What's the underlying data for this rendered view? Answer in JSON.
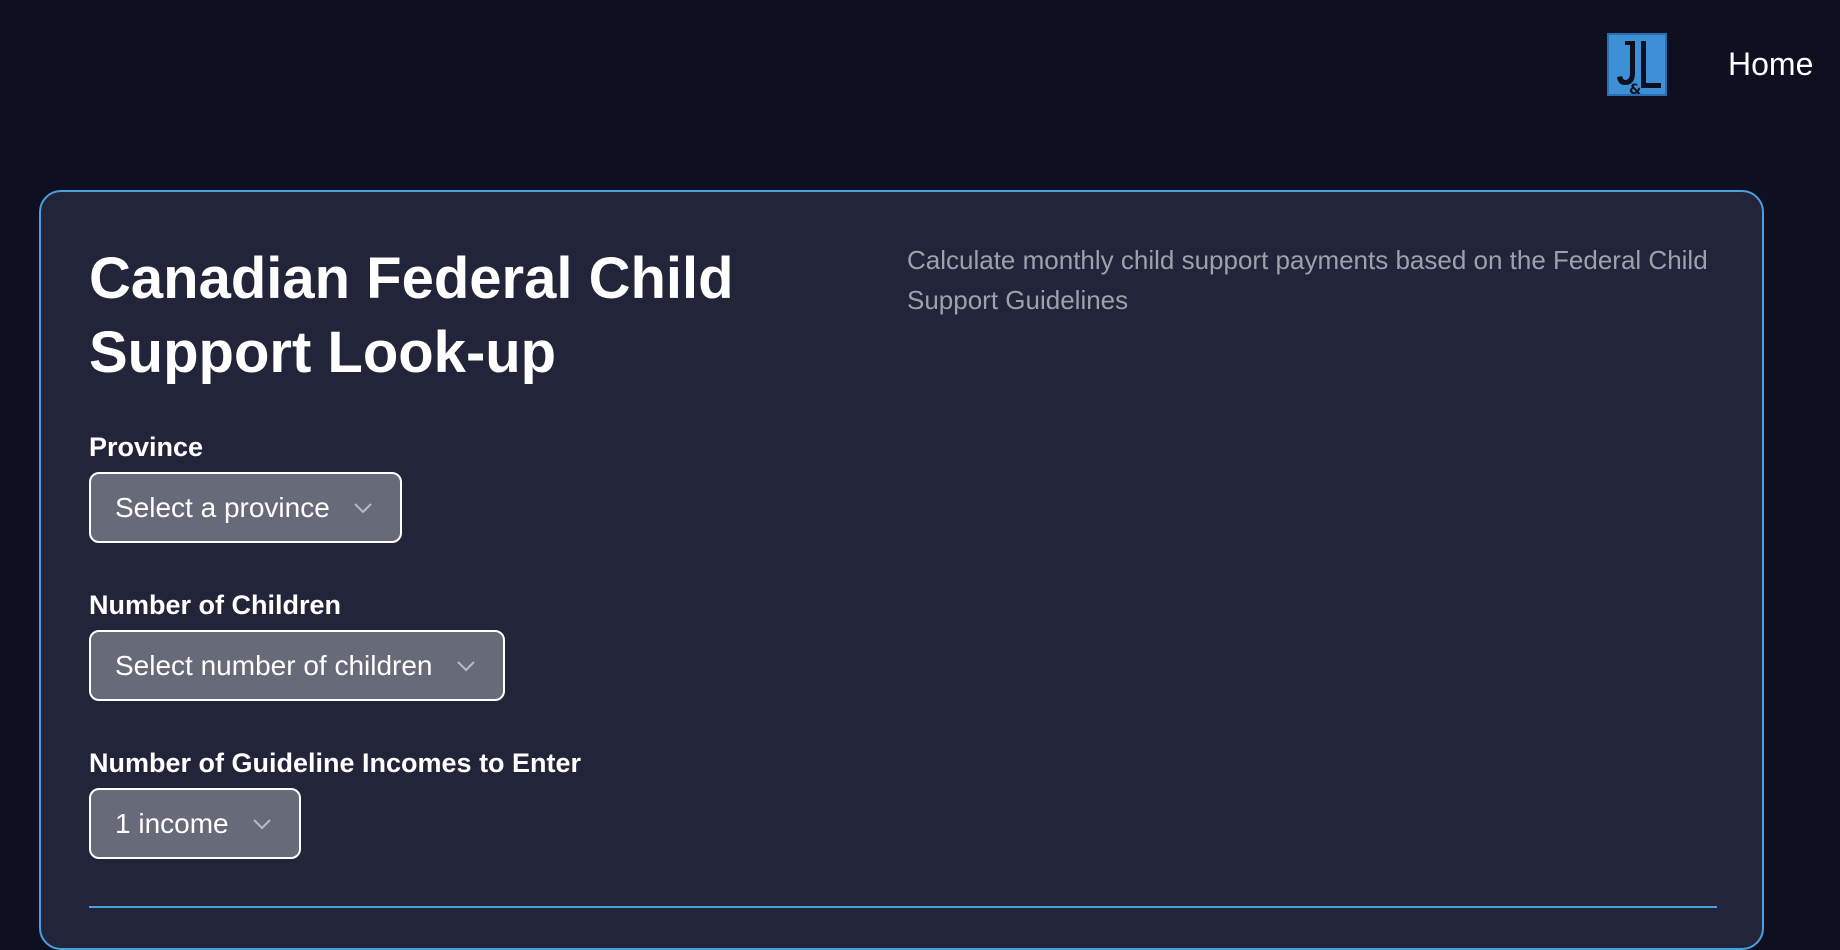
{
  "nav": {
    "logo": {
      "text": "J&L",
      "icon": "jl-logo-icon",
      "color": "#3d8fd6"
    },
    "home_label": "Home"
  },
  "card": {
    "title": "Canadian Federal Child Support Look-up",
    "description": "Calculate monthly child support payments based on the Federal Child Support Guidelines",
    "fields": [
      {
        "label": "Province",
        "value": "Select a province",
        "icon": "chevron-down-icon"
      },
      {
        "label": "Number of Children",
        "value": "Select number of children",
        "icon": "chevron-down-icon"
      },
      {
        "label": "Number of Guideline Incomes to Enter",
        "value": "1 income",
        "icon": "chevron-down-icon"
      }
    ]
  },
  "colors": {
    "background": "#0e1022",
    "card": "#222539",
    "accent": "#4a9fde",
    "select_bg": "#676a78",
    "muted_text": "#9ea0ab"
  }
}
